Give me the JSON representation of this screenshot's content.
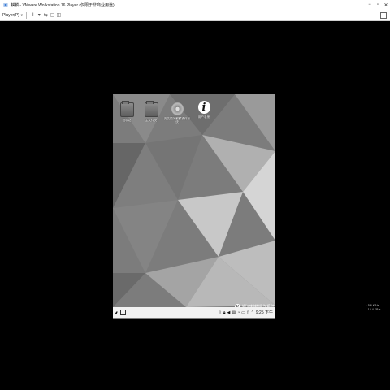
{
  "window": {
    "title": "麒麟 - VMware Workstation 16 Player (仅限于非商业用途)",
    "app_icon": "vmware-icon",
    "controls": [
      "minimize",
      "maximize",
      "close"
    ]
  },
  "toolbar": {
    "menu_label": "Player(P)",
    "buttons": [
      "pause-icon",
      "send-ctrl-alt-del-icon",
      "vm-settings-icon",
      "unity-icon"
    ]
  },
  "desktop": {
    "icons": [
      {
        "label": "回收站",
        "icon": "trash-folder-icon"
      },
      {
        "label": "主文件夹",
        "icon": "home-folder-icon"
      },
      {
        "label": "安装银河麒麟操作系统",
        "icon": "installer-disc-icon"
      },
      {
        "label": "用户手册",
        "icon": "info-icon"
      }
    ],
    "brand_text": "银河麒麟操作系统"
  },
  "taskbar": {
    "start_icon": "kylin-start-icon",
    "tray_icons": [
      "bluetooth-icon",
      "lock-icon",
      "volume-icon",
      "printer-icon",
      "network-icon",
      "keyboard-icon",
      "clipboard-icon",
      "notification-icon"
    ],
    "clock": "9:25 下午"
  },
  "net_speed": {
    "up": "↑ 5.6 KB/s",
    "down": "↓ 15.4 KB/s"
  },
  "colors": {
    "wallpaper_base": "#7a7a7a",
    "taskbar": "#f2f2f2",
    "outer_bg": "#000000"
  }
}
